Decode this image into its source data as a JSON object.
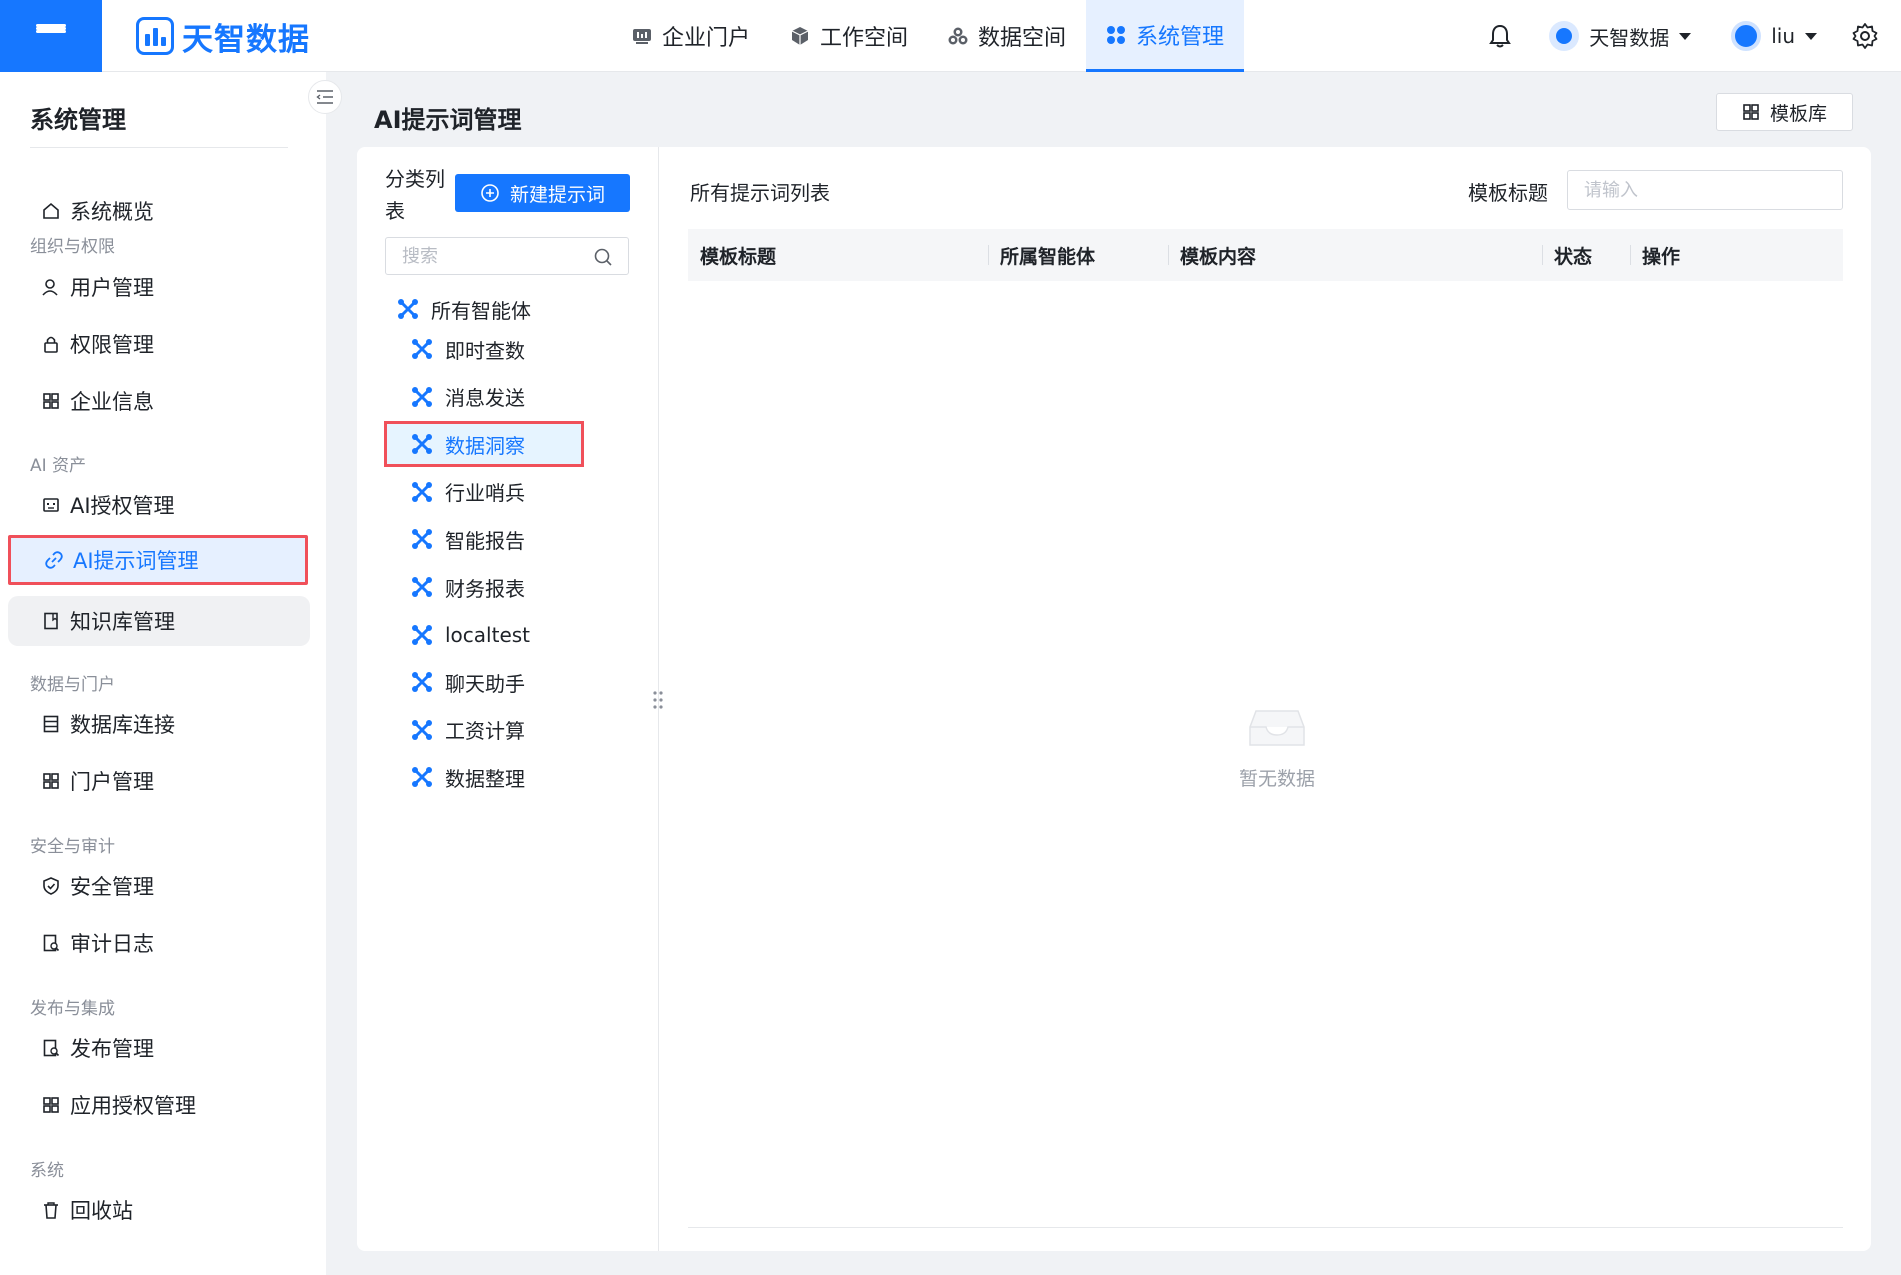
{
  "brand": {
    "name": "天智数据"
  },
  "nav": {
    "items": [
      {
        "label": "企业门户",
        "icon": "portal-icon"
      },
      {
        "label": "工作空间",
        "icon": "cube-icon"
      },
      {
        "label": "数据空间",
        "icon": "data-space-icon"
      },
      {
        "label": "系统管理",
        "icon": "system-icon",
        "active": true
      }
    ]
  },
  "header_right": {
    "org_name": "天智数据",
    "user_name": "liu"
  },
  "sidebar": {
    "title": "系统管理",
    "overview": "系统概览",
    "groups": {
      "org": "组织与权限",
      "ai": "AI 资产",
      "data": "数据与门户",
      "security": "安全与审计",
      "publish": "发布与集成",
      "system": "系统"
    },
    "items": {
      "user": "用户管理",
      "permission": "权限管理",
      "company": "企业信息",
      "ai_auth": "AI授权管理",
      "ai_prompt": "AI提示词管理",
      "knowledge": "知识库管理",
      "db_conn": "数据库连接",
      "portal": "门户管理",
      "security": "安全管理",
      "audit": "审计日志",
      "publish": "发布管理",
      "app_auth": "应用授权管理",
      "recycle": "回收站"
    }
  },
  "page": {
    "title": "AI提示词管理",
    "template_lib_button": "模板库"
  },
  "category": {
    "label": "分类列表",
    "new_button": "新建提示词",
    "search_placeholder": "搜索",
    "root": "所有智能体",
    "agents": [
      "即时查数",
      "消息发送",
      "数据洞察",
      "行业哨兵",
      "智能报告",
      "财务报表",
      "localtest",
      "聊天助手",
      "工资计算",
      "数据整理"
    ],
    "selected": "数据洞察"
  },
  "list": {
    "title": "所有提示词列表",
    "filter_label": "模板标题",
    "filter_placeholder": "请输入",
    "columns": [
      "模板标题",
      "所属智能体",
      "模板内容",
      "状态",
      "操作"
    ],
    "empty_text": "暂无数据"
  },
  "colors": {
    "accent": "#1677ff",
    "highlight_border": "#f0505a",
    "selected_bg": "#e6f0ff"
  }
}
